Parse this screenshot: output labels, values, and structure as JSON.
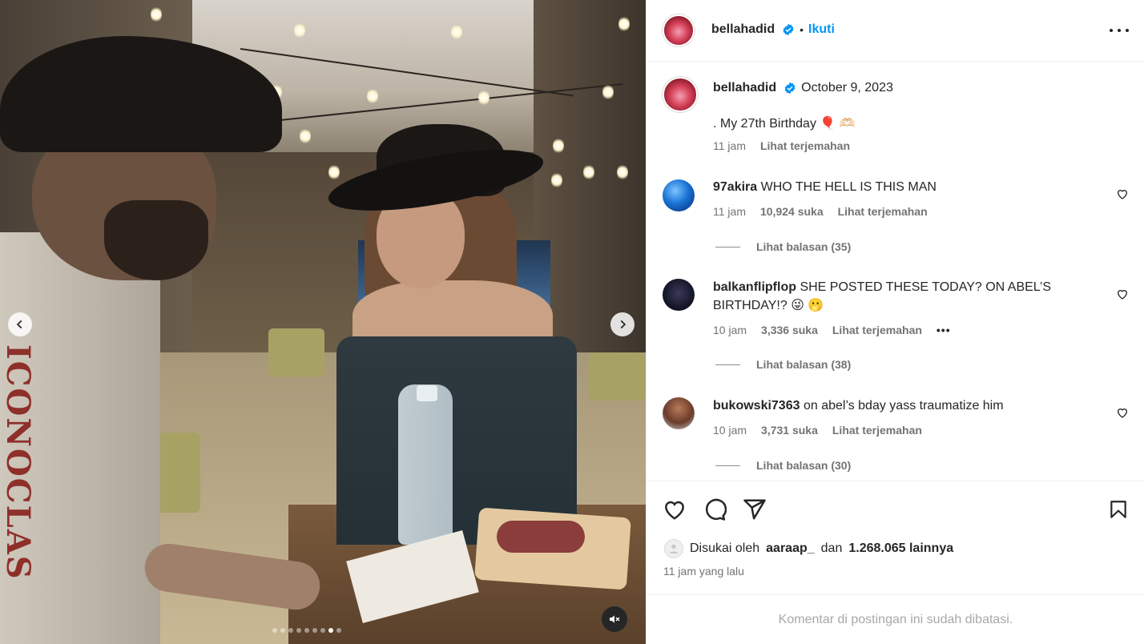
{
  "media": {
    "sleeve_text": "ICONOCLAS",
    "carousel_dots": 9,
    "active_dot": 8
  },
  "header": {
    "username": "bellahadid",
    "separator": "•",
    "follow_label": "Ikuti",
    "more_icon": "more-horizontal-icon"
  },
  "caption": {
    "username": "bellahadid",
    "date": "October 9, 2023",
    "text": ". My 27th Birthday 🎈 🫶🏻",
    "time": "11 jam",
    "translate": "Lihat terjemahan"
  },
  "comments": [
    {
      "username": "97akira",
      "text": "WHO THE HELL IS THIS MAN",
      "time": "11 jam",
      "likes": "10,924 suka",
      "translate": "Lihat terjemahan",
      "replies": "Lihat balasan (35)"
    },
    {
      "username": "balkanflipflop",
      "text": "SHE POSTED THESE TODAY? ON ABEL’S BIRTHDAY!? 😜 🫢",
      "time": "10 jam",
      "likes": "3,336 suka",
      "translate": "Lihat terjemahan",
      "more": "•••",
      "replies": "Lihat balasan (38)"
    },
    {
      "username": "bukowski7363",
      "text": "on abel’s bday yass traumatize him",
      "time": "10 jam",
      "likes": "3,731 suka",
      "translate": "Lihat terjemahan",
      "replies": "Lihat balasan (30)"
    }
  ],
  "likes": {
    "prefix": "Disukai oleh",
    "user": "aaraap_",
    "middle": "dan",
    "count": "1.268.065 lainnya"
  },
  "time_ago": "11 jam yang lalu",
  "footer": "Komentar di postingan ini sudah dibatasi.",
  "colors": {
    "accent": "#0095f6",
    "verified": "#0095f6",
    "muted": "#737373"
  }
}
